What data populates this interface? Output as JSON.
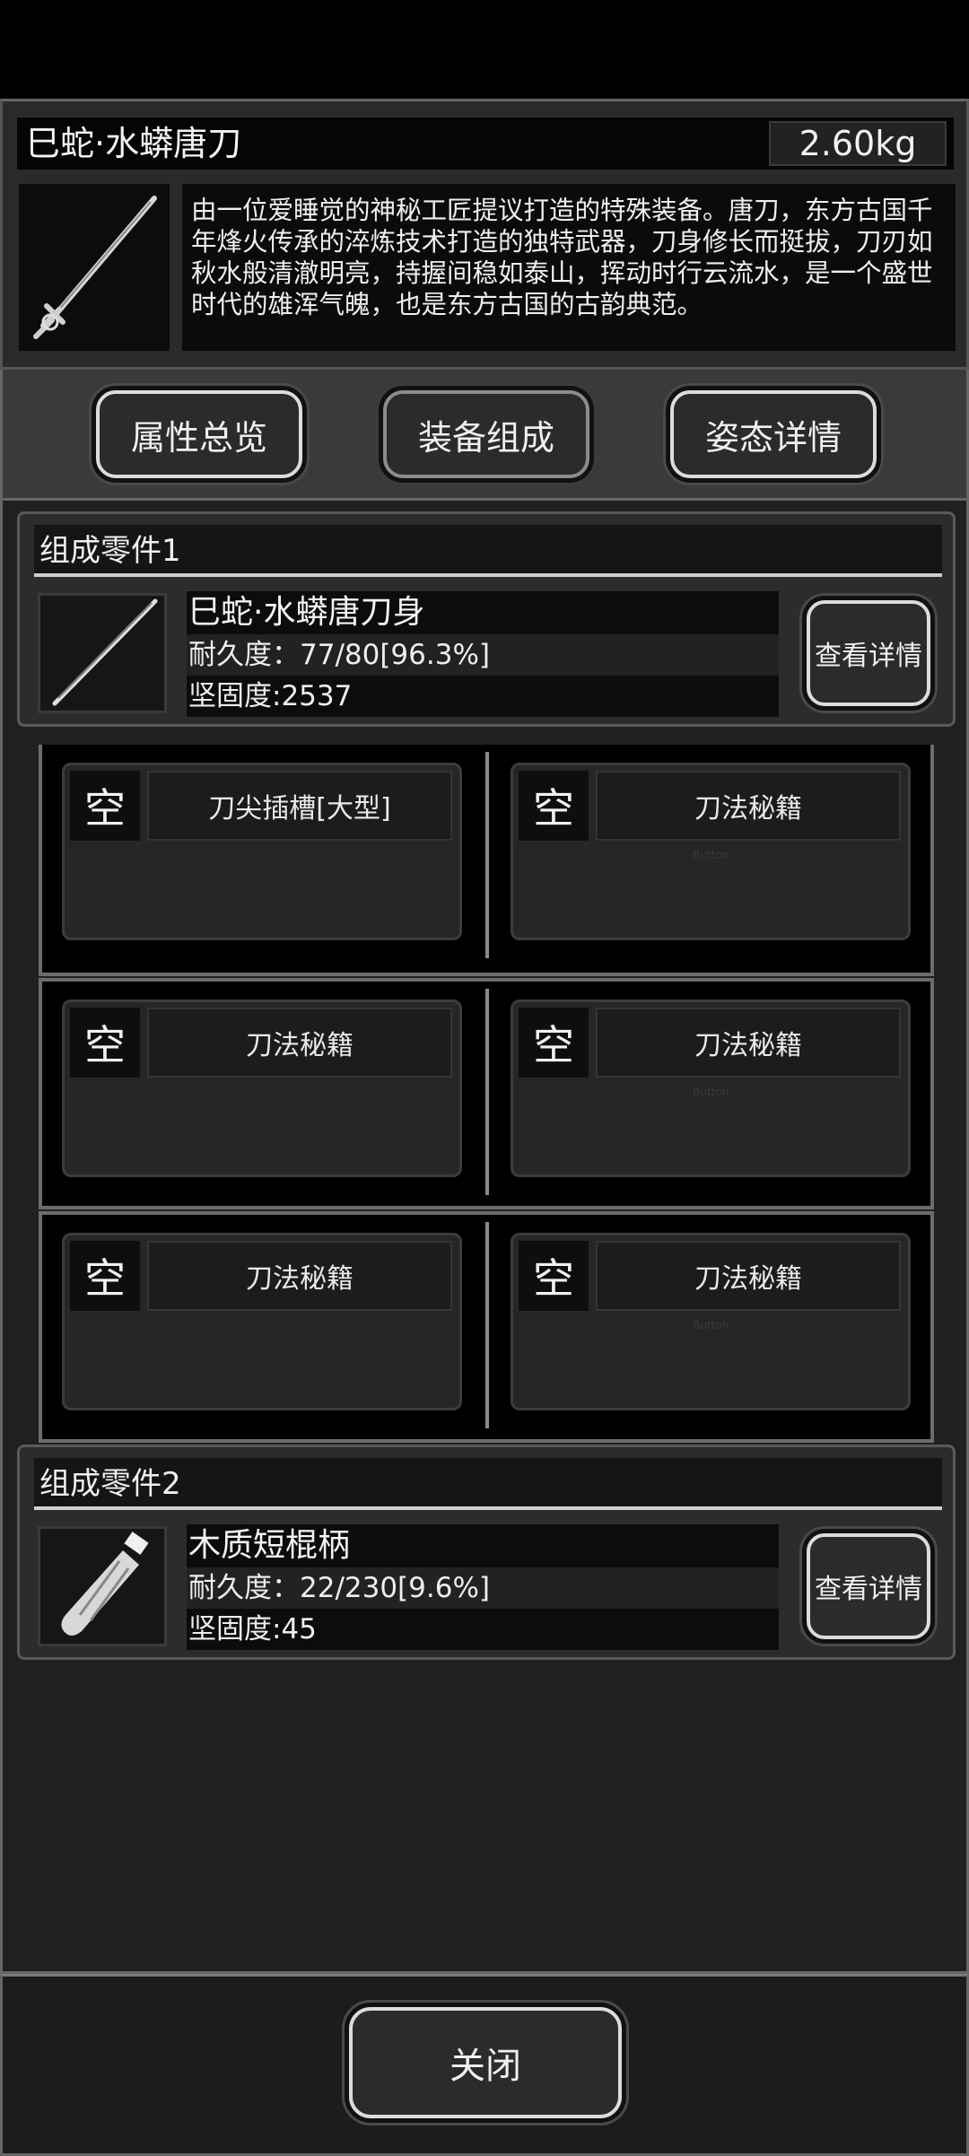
{
  "item": {
    "name": "巳蛇·水蟒唐刀",
    "weight": "2.60kg",
    "description": "由一位爱睡觉的神秘工匠提议打造的特殊装备。唐刀，东方古国千年烽火传承的淬炼技术打造的独特武器，刀身修长而挺拔，刀刃如秋水般清澈明亮，持握间稳如泰山，挥动时行云流水，是一个盛世时代的雄浑气魄，也是东方古国的古韵典范。"
  },
  "tabs": [
    "属性总览",
    "装备组成",
    "姿态详情"
  ],
  "components": [
    {
      "header": "组成零件1",
      "name": "巳蛇·水蟒唐刀身",
      "durability": "耐久度：77/80[96.3%]",
      "hardness": "坚固度:2537",
      "detail_label": "查看详情",
      "icon": "blade-icon"
    },
    {
      "header": "组成零件2",
      "name": "木质短棍柄",
      "durability": "耐久度：22/230[9.6%]",
      "hardness": "坚固度:45",
      "detail_label": "查看详情",
      "icon": "wooden-handle-icon"
    }
  ],
  "slots": [
    {
      "empty": "空",
      "label": "刀尖插槽[大型]"
    },
    {
      "empty": "空",
      "label": "刀法秘籍"
    },
    {
      "empty": "空",
      "label": "刀法秘籍"
    },
    {
      "empty": "空",
      "label": "刀法秘籍"
    },
    {
      "empty": "空",
      "label": "刀法秘籍"
    },
    {
      "empty": "空",
      "label": "刀法秘籍"
    }
  ],
  "ghost_text": "Button",
  "close_label": "关闭"
}
